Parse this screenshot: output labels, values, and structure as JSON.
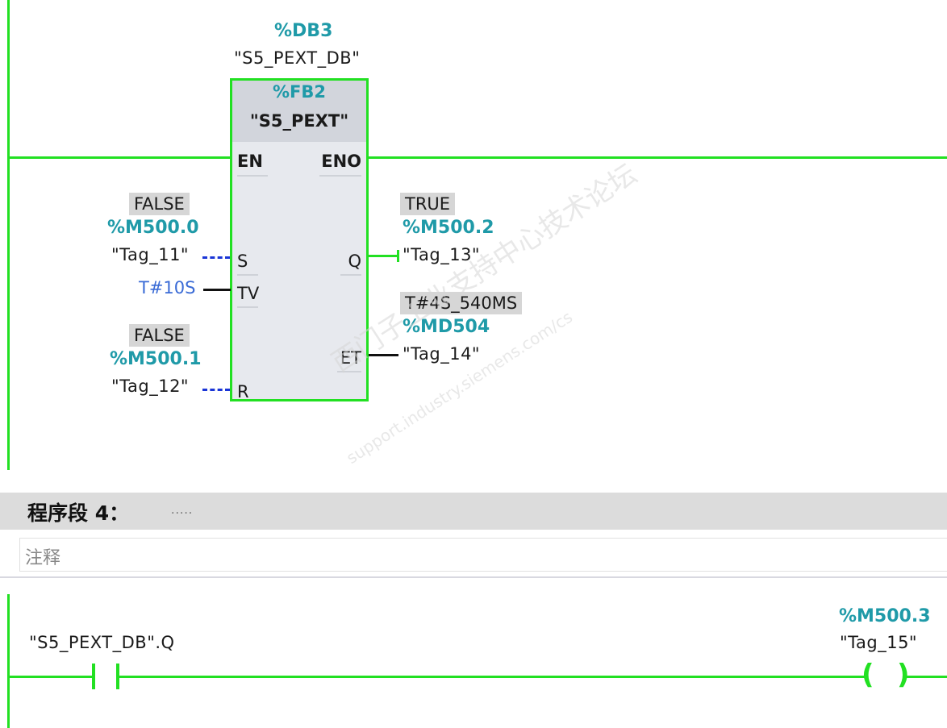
{
  "network3": {
    "instance_db_address": "%DB3",
    "instance_db_name": "\"S5_PEXT_DB\"",
    "block_type": "%FB2",
    "block_name": "\"S5_PEXT\"",
    "pins": {
      "en": "EN",
      "eno": "ENO",
      "s": "S",
      "tv": "TV",
      "r": "R",
      "q": "Q",
      "et": "ET"
    },
    "s_input": {
      "value": "FALSE",
      "address": "%M500.0",
      "tag": "\"Tag_11\""
    },
    "tv_input": {
      "constant": "T#10S"
    },
    "r_input": {
      "value": "FALSE",
      "address": "%M500.1",
      "tag": "\"Tag_12\""
    },
    "q_output": {
      "value": "TRUE",
      "address": "%M500.2",
      "tag": "\"Tag_13\""
    },
    "et_output": {
      "value": "T#4S_540MS",
      "address": "%MD504",
      "tag": "\"Tag_14\""
    }
  },
  "network4": {
    "title": "程序段 4：",
    "title_dots": ".....",
    "comment_placeholder": "注释",
    "contact_operand": "\"S5_PEXT_DB\".Q",
    "coil_address": "%M500.3",
    "coil_tag": "\"Tag_15\""
  },
  "watermark": {
    "line1": "西门子工业支持中心技术论坛",
    "line2": "support.industry.siemens.com/cs"
  },
  "colors": {
    "energy_flow": "#22e022",
    "address": "#1f9aa8",
    "constant": "#3a6bd6",
    "dashed_wire": "#1a35d6"
  }
}
